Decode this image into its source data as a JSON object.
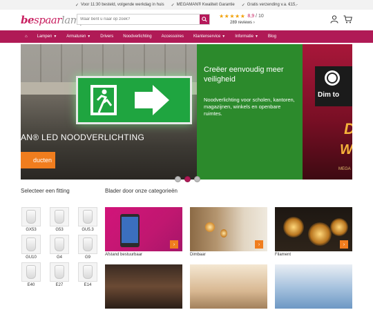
{
  "topbar": {
    "usps": [
      "Voor 11:30 besteld, volgende werkdag in huis",
      "MEGAMAN® Kwaliteit Garantie",
      "Gratis verzending v.a. €15,-"
    ]
  },
  "header": {
    "logo": {
      "part1": "be",
      "part2": "spaar",
      "part3": "lamp"
    },
    "search_placeholder": "Waar bent u naar op zoek?",
    "rating": {
      "stars": "★★★★★",
      "score": "8,9",
      "max": "10",
      "reviews": "289 reviews"
    }
  },
  "nav": {
    "items": [
      {
        "label": "Lampen",
        "dropdown": true
      },
      {
        "label": "Armaturen",
        "dropdown": true
      },
      {
        "label": "Drivers",
        "dropdown": false
      },
      {
        "label": "Noodverlichting",
        "dropdown": false
      },
      {
        "label": "Accessoires",
        "dropdown": false
      },
      {
        "label": "Klantenservice",
        "dropdown": true
      },
      {
        "label": "Informatie",
        "dropdown": true
      },
      {
        "label": "Blog",
        "dropdown": false
      }
    ]
  },
  "hero": {
    "headline": "AN® LED NOODVERLICHTING",
    "cta": "ducten",
    "title": "Creëer eenvoudig meer veiligheid",
    "text": "Noodverlichting voor scholen, kantoren, magazijnen, winkels en openbare ruimtes.",
    "side_text": "Dim to",
    "side_big1": "D",
    "side_big2": "W",
    "side_brand": "MEGA",
    "slides": 3,
    "active_slide": 2
  },
  "fittings": {
    "title": "Selecteer een fitting",
    "items": [
      "GX53",
      "G53",
      "GU5.3",
      "GU10",
      "G4",
      "G9",
      "E40",
      "E27",
      "E14"
    ]
  },
  "categories": {
    "title": "Blader door onze categorieën",
    "items": [
      {
        "label": "Afstand bestuurbaar"
      },
      {
        "label": "Dimbaar"
      },
      {
        "label": "Filament"
      },
      {
        "label": ""
      },
      {
        "label": ""
      },
      {
        "label": ""
      }
    ]
  },
  "colors": {
    "brand": "#b01a56",
    "accent": "#f07d1e",
    "star": "#f2a20b"
  }
}
